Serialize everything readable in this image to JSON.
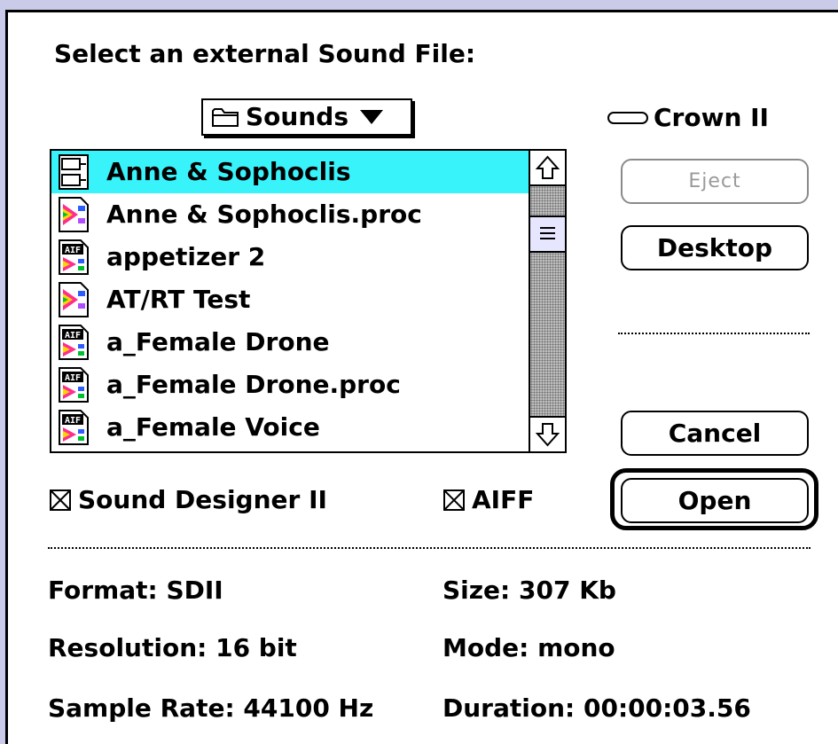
{
  "dialog": {
    "prompt": "Select an external Sound File:",
    "folder_popup": {
      "label": "Sounds",
      "icon": "folder-icon"
    },
    "volume": {
      "label": "Crown II",
      "icon": "disk-icon"
    },
    "files": [
      {
        "name": "Anne & Sophoclis",
        "icon": "sd2-file-icon",
        "selected": true
      },
      {
        "name": "Anne & Sophoclis.proc",
        "icon": "proc-file-icon",
        "selected": false
      },
      {
        "name": "appetizer 2",
        "icon": "aif-file-icon",
        "selected": false
      },
      {
        "name": "AT/RT Test",
        "icon": "proc-file-icon",
        "selected": false
      },
      {
        "name": "a_Female Drone",
        "icon": "aif-file-icon",
        "selected": false
      },
      {
        "name": "a_Female Drone.proc",
        "icon": "aif-file-icon",
        "selected": false
      },
      {
        "name": "a_Female Voice",
        "icon": "aif-file-icon",
        "selected": false
      }
    ],
    "scroll_position": 0.15,
    "buttons": {
      "eject": "Eject",
      "desktop": "Desktop",
      "cancel": "Cancel",
      "open": "Open"
    },
    "filters": {
      "sd2": {
        "label": "Sound Designer II",
        "checked": true
      },
      "aiff": {
        "label": "AIFF",
        "checked": true
      }
    },
    "info": {
      "format": "Format: SDII",
      "resolution": "Resolution: 16 bit",
      "sample_rate": "Sample Rate: 44100 Hz",
      "size": "Size: 307 Kb",
      "mode": "Mode: mono",
      "duration": "Duration: 00:00:03.56"
    }
  },
  "colors": {
    "selection": "#39f3fb",
    "background": "#c9cbe8"
  }
}
